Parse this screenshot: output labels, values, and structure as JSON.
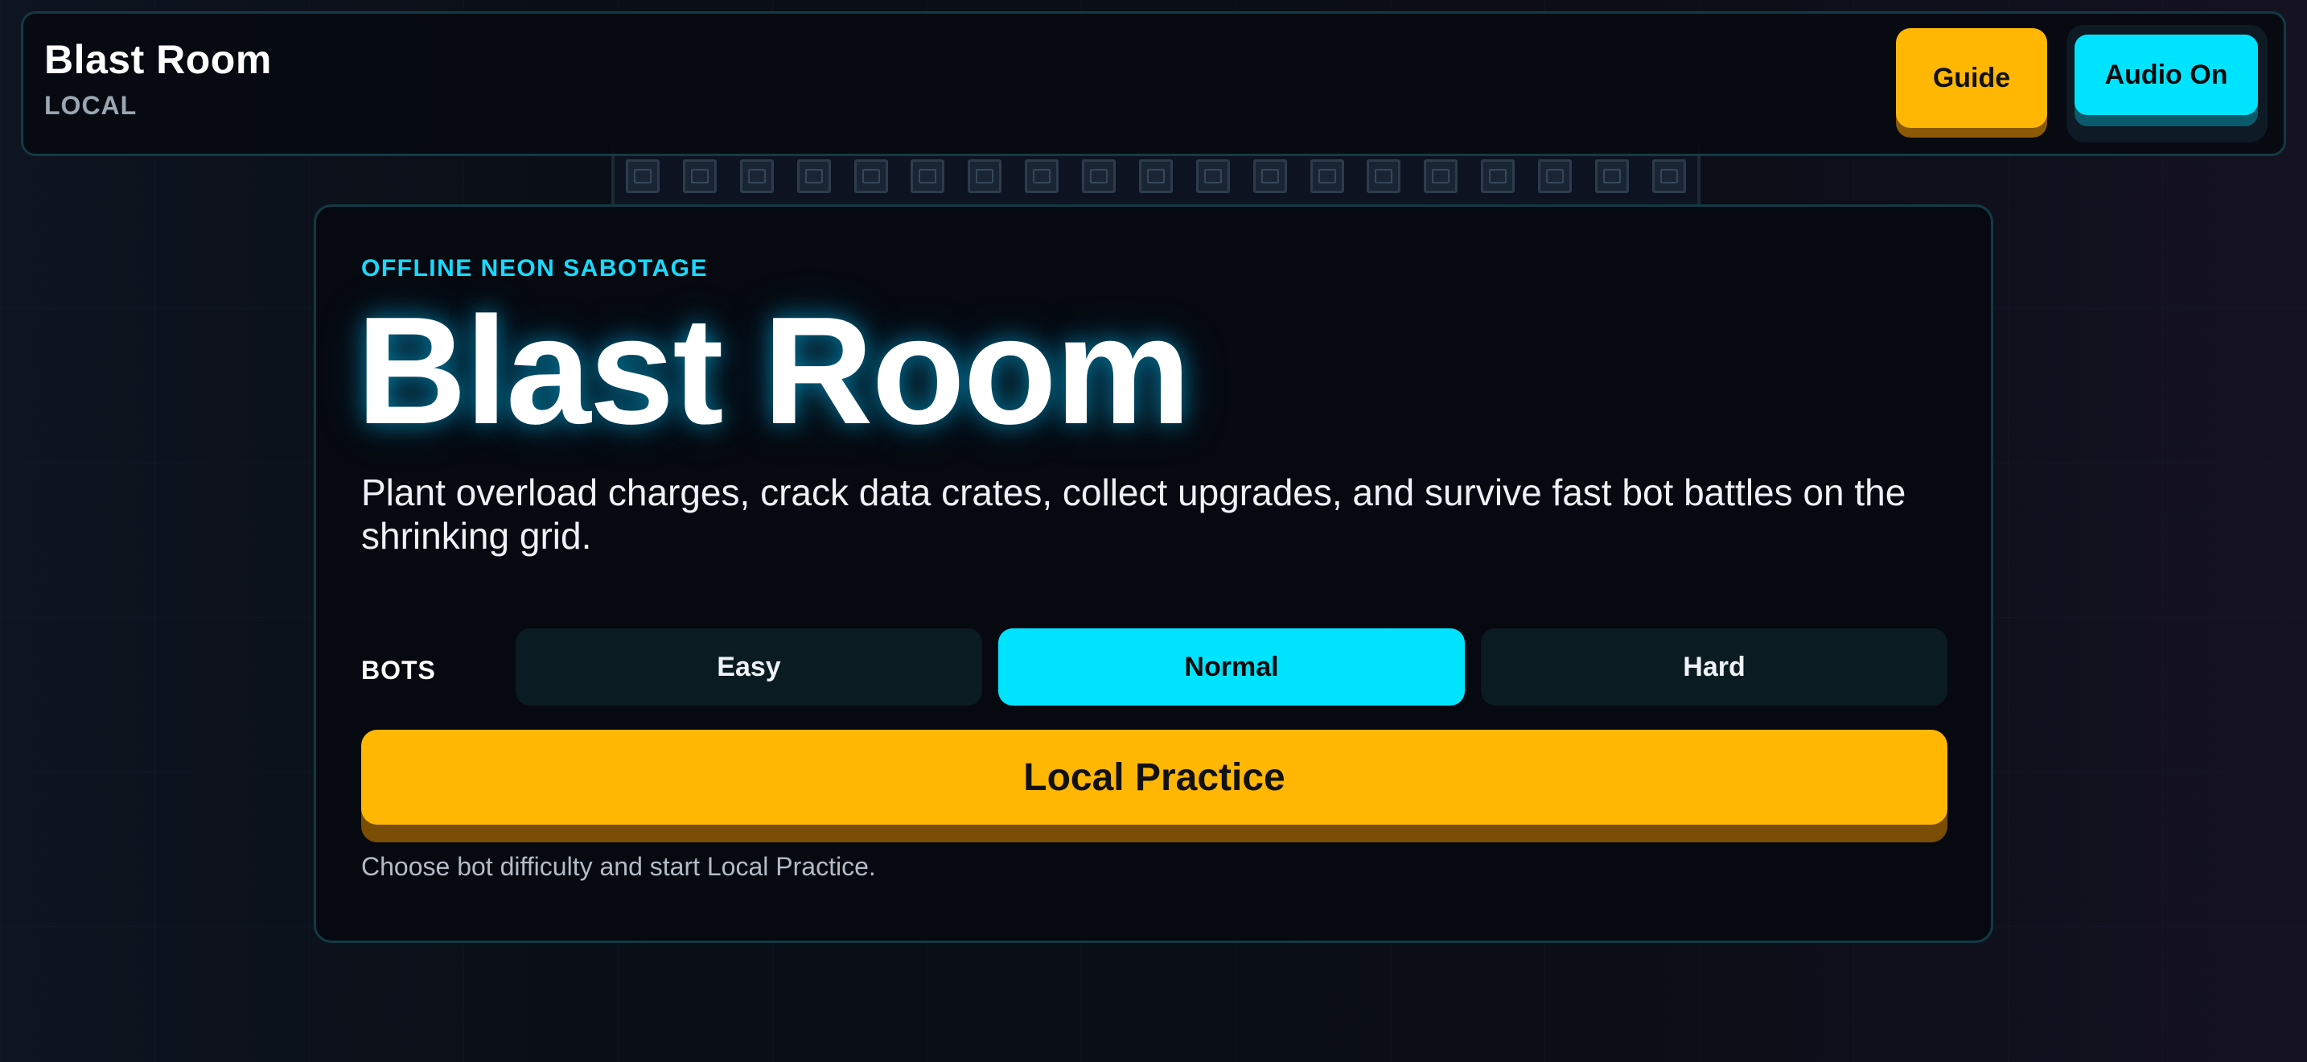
{
  "topbar": {
    "title": "Blast Room",
    "mode": "LOCAL",
    "guide_label": "Guide",
    "audio_label": "Audio On"
  },
  "hero": {
    "kicker": "OFFLINE NEON SABOTAGE",
    "title": "Blast Room",
    "description": "Plant overload charges, crack data crates, collect upgrades, and survive fast bot battles on the shrinking grid."
  },
  "difficulty": {
    "label": "BOTS",
    "options": [
      "Easy",
      "Normal",
      "Hard"
    ],
    "selected": "Normal"
  },
  "actions": {
    "start_label": "Local Practice",
    "hint": "Choose bot difficulty and start Local Practice."
  },
  "colors": {
    "accent_cyan": "#00e3ff",
    "accent_amber": "#ffb703",
    "panel_border": "#123a44"
  },
  "icons": {
    "arena_tile": "data-crate-icon"
  }
}
